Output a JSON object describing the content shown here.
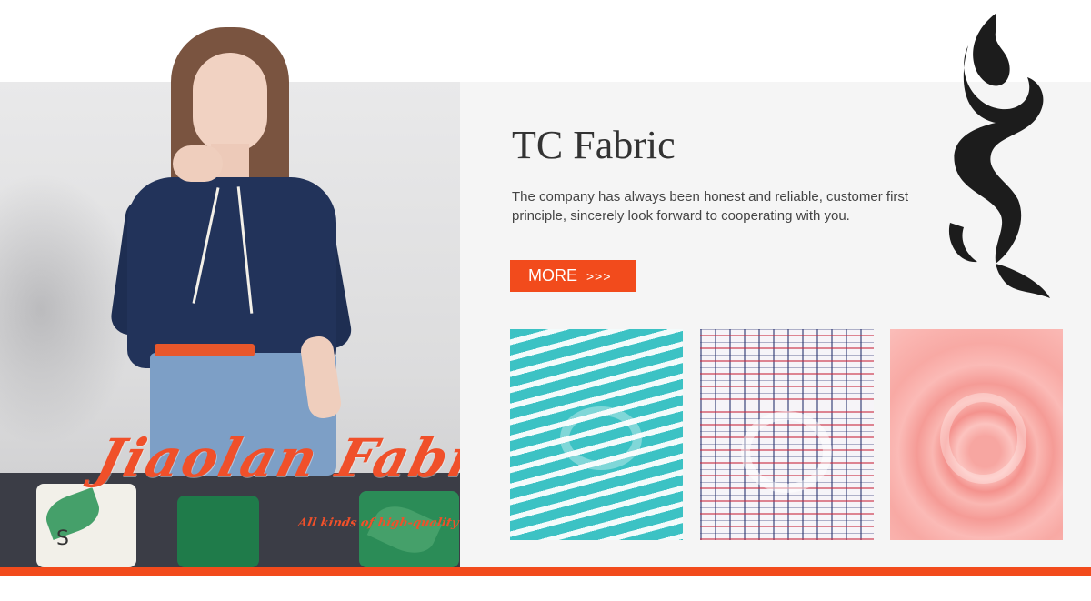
{
  "hero": {
    "brand_script": "Jiaolan Fabric",
    "brand_tagline": "All kinds of high-quality fabrics",
    "pillow_letter": "S"
  },
  "content": {
    "title": "TC Fabric",
    "description": "The company has always been honest and reliable, customer first principle, sincerely look forward to cooperating with you.",
    "more_label": "MORE",
    "more_arrows": ">>>"
  },
  "swatches": [
    {
      "pattern": "teal-white-stripes"
    },
    {
      "pattern": "multicolor-plaid"
    },
    {
      "pattern": "pink-jacquard"
    }
  ],
  "colors": {
    "accent": "#f24b1c",
    "title_text": "#333333",
    "panel_bg": "#f5f5f5",
    "phoenix": "#1c1c1c"
  },
  "icons": {
    "decoration": "phoenix-icon"
  }
}
